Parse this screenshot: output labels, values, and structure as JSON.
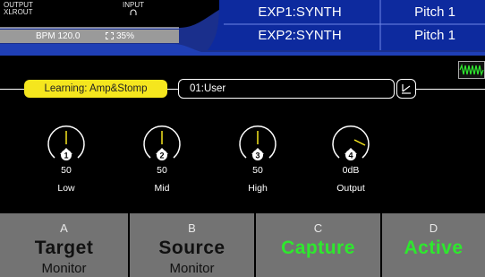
{
  "header": {
    "output_label": "OUTPUT",
    "output_value": "XLROUT",
    "input_label": "INPUT",
    "input_icon": "headphone-icon",
    "bpm": "BPM 120.0",
    "cpu": "35%",
    "cpu_icon": "cpu-icon",
    "exp1": "EXP1:SYNTH",
    "exp2": "EXP2:SYNTH",
    "exp1_value": "Pitch 1",
    "exp2_value": "Pitch 1",
    "accent": "#1f3fb5"
  },
  "learning": {
    "label": "Learning: Amp&Stomp",
    "preset": "01:User",
    "save_icon": "save-pen-icon",
    "wave_icon": "waveform-icon",
    "tag_color": "#f5e61e"
  },
  "knobs": [
    {
      "num": "1",
      "value": "50",
      "label": "Low",
      "level": 0.5
    },
    {
      "num": "2",
      "value": "50",
      "label": "Mid",
      "level": 0.5
    },
    {
      "num": "3",
      "value": "50",
      "label": "High",
      "level": 0.5
    },
    {
      "num": "4",
      "value": "0dB",
      "label": "Output",
      "level": 0.75
    }
  ],
  "buttons": [
    {
      "letter": "A",
      "main": "Target",
      "sub": "Monitor"
    },
    {
      "letter": "B",
      "main": "Source",
      "sub": "Monitor"
    },
    {
      "letter": "C",
      "main": "Capture",
      "sub": ""
    },
    {
      "letter": "D",
      "main": "Active",
      "sub": ""
    }
  ],
  "colors": {
    "active_green": "#2ee82e",
    "button_gray": "#737373"
  }
}
